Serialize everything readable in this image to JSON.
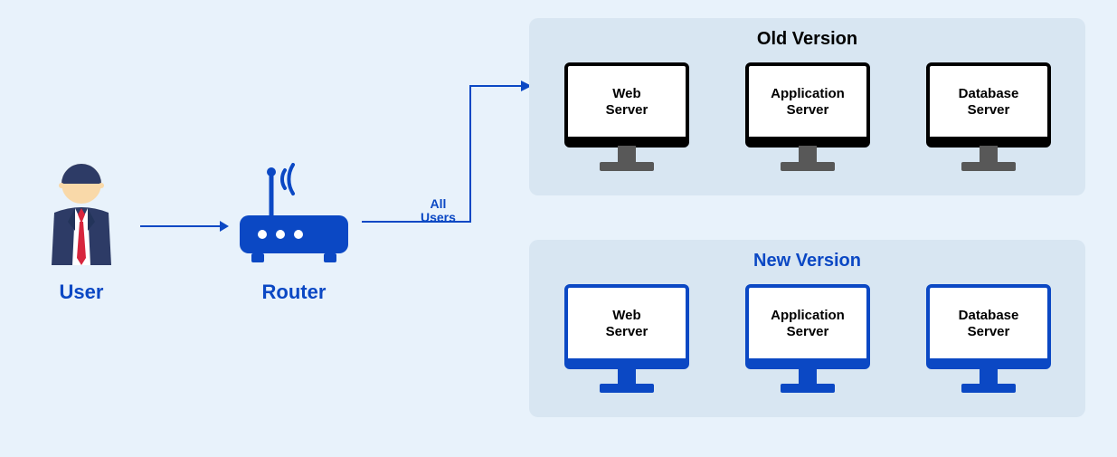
{
  "user": {
    "label": "User"
  },
  "router": {
    "label": "Router"
  },
  "edge": {
    "label_line1": "All",
    "label_line2": "Users"
  },
  "old_version": {
    "title": "Old Version",
    "servers": [
      {
        "line1": "Web",
        "line2": "Server"
      },
      {
        "line1": "Application",
        "line2": "Server"
      },
      {
        "line1": "Database",
        "line2": "Server"
      }
    ]
  },
  "new_version": {
    "title": "New Version",
    "servers": [
      {
        "line1": "Web",
        "line2": "Server"
      },
      {
        "line1": "Application",
        "line2": "Server"
      },
      {
        "line1": "Database",
        "line2": "Server"
      }
    ]
  }
}
